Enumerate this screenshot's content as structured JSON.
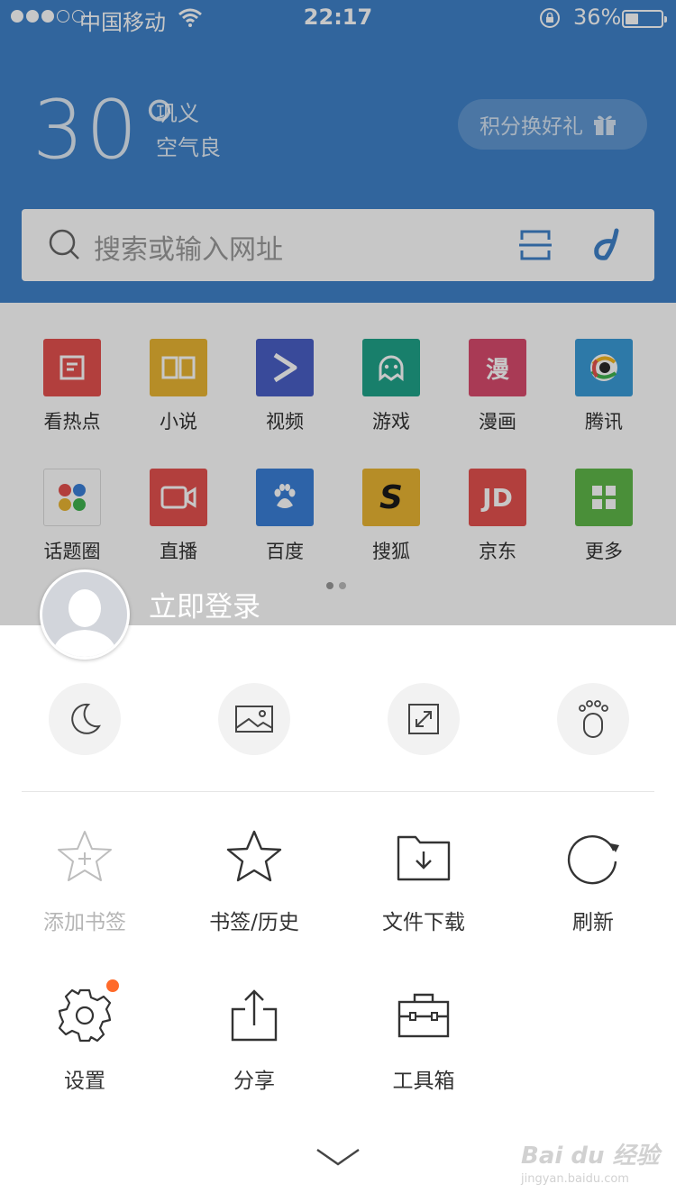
{
  "status_bar": {
    "carrier": "中国移动",
    "time": "22:17",
    "battery": "36%"
  },
  "weather": {
    "temperature": "30°",
    "city": "巩义",
    "air_quality": "空气良"
  },
  "gift_button": {
    "label": "积分换好礼",
    "icon": "gift-icon"
  },
  "search": {
    "placeholder": "搜索或输入网址"
  },
  "shortcuts": [
    {
      "label": "看热点",
      "color": "#e4514f",
      "icon": "news-icon"
    },
    {
      "label": "小说",
      "color": "#e9b532",
      "icon": "book-icon"
    },
    {
      "label": "视频",
      "color": "#4a5fc6",
      "icon": "play-icon"
    },
    {
      "label": "游戏",
      "color": "#1fa38a",
      "icon": "ghost-icon"
    },
    {
      "label": "漫画",
      "color": "#d94b6d",
      "icon": "comic-icon",
      "glyph": "漫"
    },
    {
      "label": "腾讯",
      "color": "#3a9bd8",
      "icon": "tencent-icon"
    },
    {
      "label": "话题圈",
      "color": "#ffffff",
      "icon": "topic-icon"
    },
    {
      "label": "直播",
      "color": "#e4514f",
      "icon": "live-icon"
    },
    {
      "label": "百度",
      "color": "#3a7fd8",
      "icon": "baidu-paw-icon"
    },
    {
      "label": "搜狐",
      "color": "#e9b532",
      "icon": "sohu-icon",
      "glyph": "S"
    },
    {
      "label": "京东",
      "color": "#e4514f",
      "icon": "jd-icon",
      "glyph": "JD"
    },
    {
      "label": "更多",
      "color": "#5fb84a",
      "icon": "grid-icon"
    }
  ],
  "sheet": {
    "login_label": "立即登录",
    "quick_actions": [
      {
        "name": "night-mode",
        "icon": "moon-icon"
      },
      {
        "name": "no-image-mode",
        "icon": "image-icon"
      },
      {
        "name": "fullscreen",
        "icon": "expand-icon"
      },
      {
        "name": "incognito",
        "icon": "footprint-icon"
      }
    ],
    "menu": [
      {
        "label": "添加书签",
        "icon": "star-plus-icon",
        "enabled": false
      },
      {
        "label": "书签/历史",
        "icon": "star-icon",
        "enabled": true
      },
      {
        "label": "文件下载",
        "icon": "folder-download-icon",
        "enabled": true
      },
      {
        "label": "刷新",
        "icon": "refresh-icon",
        "enabled": true
      },
      {
        "label": "设置",
        "icon": "gear-icon",
        "enabled": true,
        "badge": true
      },
      {
        "label": "分享",
        "icon": "share-icon",
        "enabled": true
      },
      {
        "label": "工具箱",
        "icon": "toolbox-icon",
        "enabled": true
      }
    ]
  },
  "watermark": {
    "brand": "Bai du 经验",
    "url": "jingyan.baidu.com"
  },
  "colors": {
    "header_blue": "#3f82c9",
    "badge_orange": "#ff6a2a"
  }
}
